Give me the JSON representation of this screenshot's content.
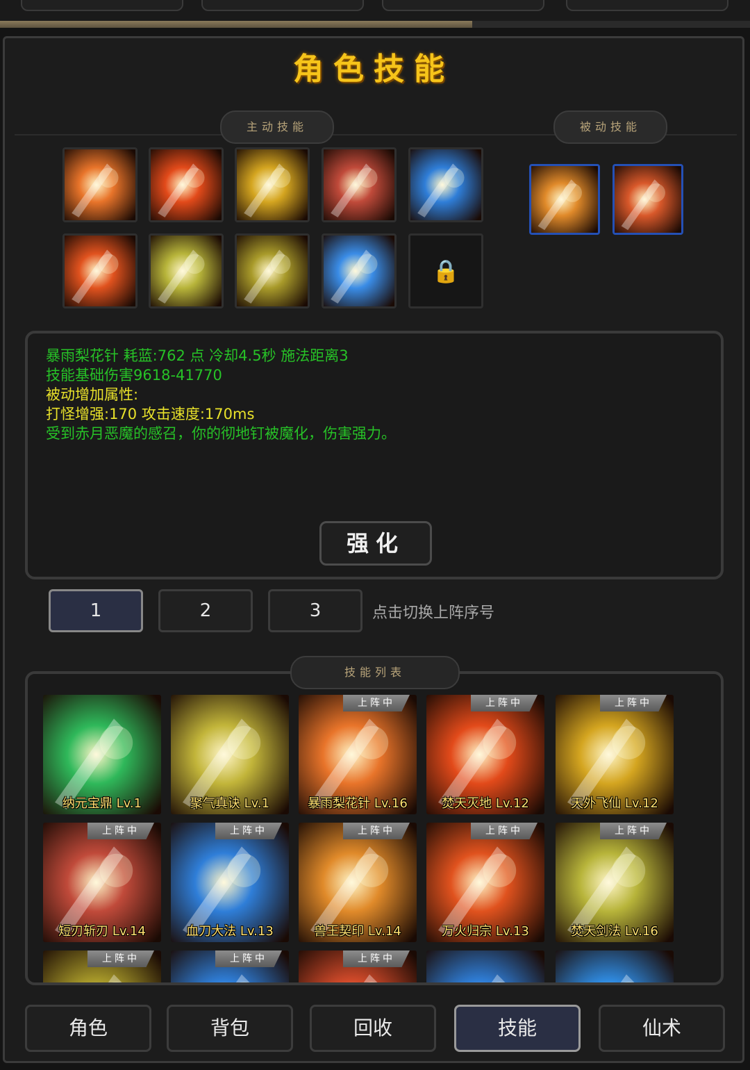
{
  "title": "角色技能",
  "sections": {
    "active": "主动技能",
    "passive": "被动技能",
    "list": "技能列表"
  },
  "active_skills": [
    {
      "icon": "arrow-rain-icon",
      "color": "#e8742a"
    },
    {
      "icon": "flame-burst-icon",
      "color": "#e24a1a"
    },
    {
      "icon": "golden-sword-icon",
      "color": "#d4a520"
    },
    {
      "icon": "blade-ring-icon",
      "color": "#c04a3a"
    },
    {
      "icon": "ice-claw-icon",
      "color": "#2f7ed8"
    },
    {
      "icon": "meteor-icon",
      "color": "#e0521e"
    },
    {
      "icon": "sword-slash-icon",
      "color": "#b7b43a"
    },
    {
      "icon": "dragon-icon",
      "color": "#a89a2a"
    },
    {
      "icon": "frost-burst-icon",
      "color": "#3a8ce6"
    },
    {
      "icon": "lock-icon",
      "locked": true
    }
  ],
  "passive_skills": [
    {
      "icon": "dragon-claw-icon",
      "color": "#e08a2a"
    },
    {
      "icon": "yin-yang-icon",
      "color": "#d8582a"
    }
  ],
  "info": {
    "line1": {
      "name": "暴雨梨花针",
      "rest": "  耗蓝:762 点  冷却4.5秒  施法距离3"
    },
    "line2": "技能基础伤害9618-41770",
    "line3": "被动增加属性:",
    "line4": "打怪增强:170    攻击速度:170ms",
    "line5": "受到赤月恶魔的感召，你的彻地钉被魔化，伤害强力。"
  },
  "enhance_label": "强化",
  "sequence": {
    "buttons": [
      "1",
      "2",
      "3"
    ],
    "active": "1",
    "hint": "点击切换上阵序号"
  },
  "badge_text": "上阵中",
  "skill_list": [
    {
      "name": "纳元宝鼎 Lv.1",
      "icon": "bagua-icon",
      "color": "#2fb85a",
      "deployed": false
    },
    {
      "name": "聚气真诀 Lv.1",
      "icon": "meditation-icon",
      "color": "#c2b53a",
      "deployed": false
    },
    {
      "name": "暴雨梨花针 Lv.16",
      "icon": "arrow-rain-icon",
      "color": "#e8742a",
      "deployed": true
    },
    {
      "name": "焚天灭地 Lv.12",
      "icon": "flame-burst-icon",
      "color": "#e24a1a",
      "deployed": true
    },
    {
      "name": "天外飞仙 Lv.12",
      "icon": "golden-sword-icon",
      "color": "#d4a520",
      "deployed": true
    },
    {
      "name": "短刃斩刃 Lv.14",
      "icon": "blade-ring-icon",
      "color": "#c04a3a",
      "deployed": true
    },
    {
      "name": "血刀大法 Lv.13",
      "icon": "ice-claw-icon",
      "color": "#2f7ed8",
      "deployed": true
    },
    {
      "name": "兽王契印 Lv.14",
      "icon": "dragon-claw-icon",
      "color": "#e08a2a",
      "deployed": true
    },
    {
      "name": "万火归宗 Lv.13",
      "icon": "meteor-icon",
      "color": "#e0521e",
      "deployed": true
    },
    {
      "name": "焚天剑法 Lv.16",
      "icon": "sword-slash-icon",
      "color": "#b7b43a",
      "deployed": true
    },
    {
      "name": "",
      "icon": "dragon-icon",
      "color": "#a89a2a",
      "deployed": true
    },
    {
      "name": "",
      "icon": "frost-burst-icon",
      "color": "#2f7ed8",
      "deployed": true
    },
    {
      "name": "",
      "icon": "fire-orb-icon",
      "color": "#d24a2a",
      "deployed": true
    },
    {
      "name": "",
      "icon": "wave-icon",
      "color": "#2f7ed8",
      "deployed": false
    },
    {
      "name": "",
      "icon": "water-vortex-icon",
      "color": "#2f8ae0",
      "deployed": false
    }
  ],
  "nav": [
    "角色",
    "背包",
    "回收",
    "技能",
    "仙术"
  ],
  "nav_active": "技能",
  "progress_fraction": 0.63
}
